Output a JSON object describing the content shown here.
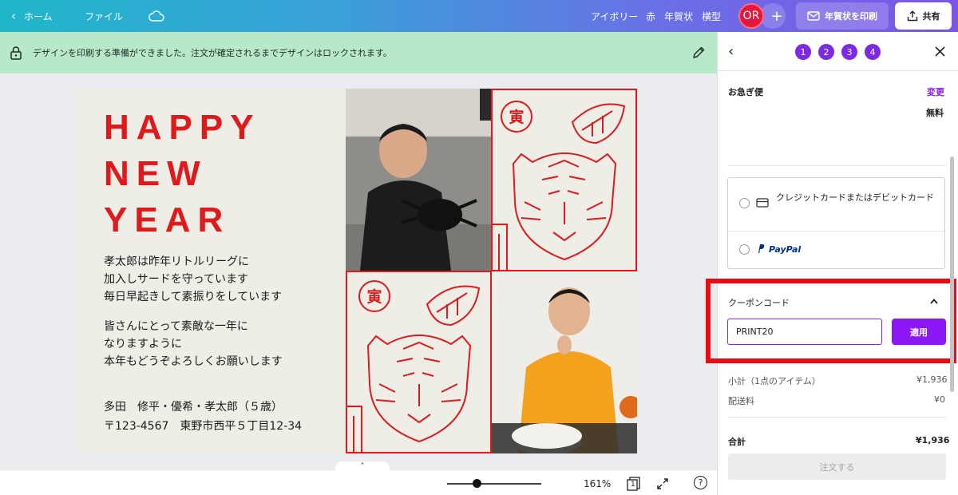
{
  "topbar": {
    "home_label": "ホーム",
    "file_label": "ファイル",
    "menu_items": [
      "アイボリー",
      "赤",
      "年賀状",
      "横型"
    ],
    "avatar_initials": "OR",
    "plus_label": "+",
    "print_label": "年賀状を印刷",
    "share_label": "共有"
  },
  "notice": {
    "message": "デザインを印刷する準備ができました。注文が確定されるまでデザインはロックされます。"
  },
  "card": {
    "headline": [
      "HAPPY",
      "NEW",
      "YEAR"
    ],
    "message_1": [
      "孝太郎は昨年リトルリーグに",
      "加入しサードを守っています",
      "毎日早起きして素振りをしています"
    ],
    "message_2": [
      "皆さんにとって素敵な一年に",
      "なりますように",
      "本年もどうぞよろしくお願いします"
    ],
    "names": "多田　修平・優希・孝太郎（５歳）",
    "address": "〒123-4567　東野市西平５丁目12-34",
    "stamp_char": "寅"
  },
  "bottombar": {
    "zoom": "161%",
    "zoom_fraction": 0.31,
    "page_count": "1",
    "help": "?"
  },
  "panel": {
    "steps": [
      "1",
      "2",
      "3",
      "4"
    ],
    "express_label": "お急ぎ便",
    "change_label": "変更",
    "free_label": "無料",
    "payment_card_label": "クレジットカードまたはデビットカード",
    "paypal_label": "PayPal",
    "coupon_title": "クーポンコード",
    "coupon_value": "PRINT20",
    "apply_label": "適用",
    "subtotal_label": "小計（1点のアイテム）",
    "subtotal_value": "¥1,936",
    "shipping_label": "配送料",
    "shipping_value": "¥0",
    "total_label": "合計",
    "total_value": "¥1,936",
    "order_label": "注文する"
  },
  "colors": {
    "accent": "#7d2ae8",
    "highlight": "#ee0a12",
    "card_red": "#e0191d",
    "notice_bg": "#b7e8c9"
  }
}
